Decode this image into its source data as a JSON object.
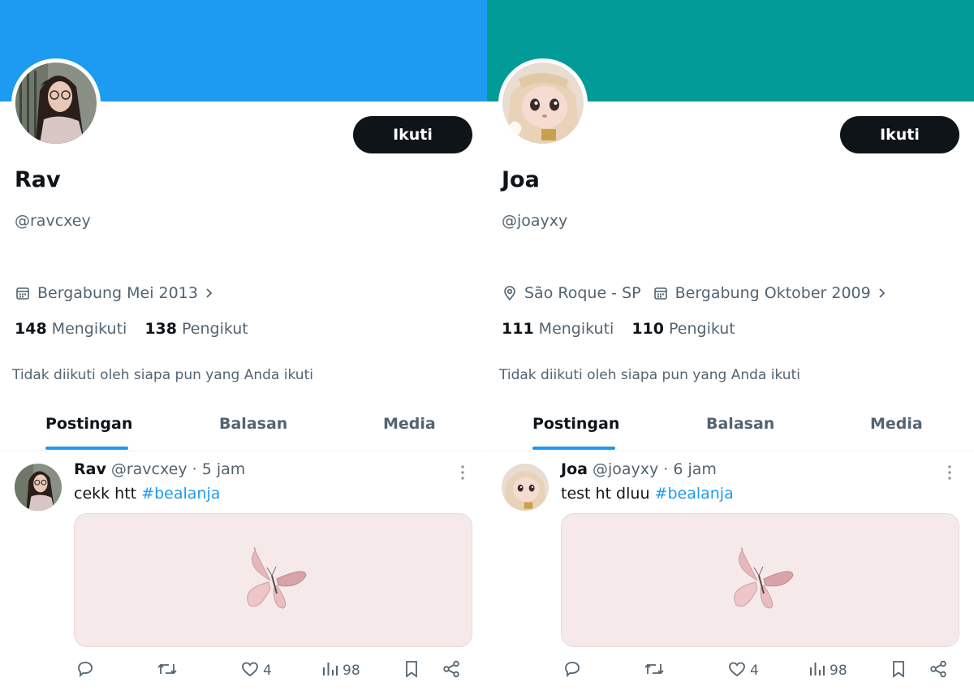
{
  "profiles": [
    {
      "banner_color": "#1d9bf0",
      "display_name": "Rav",
      "handle": "@ravcxey",
      "follow_label": "Ikuti",
      "location": "",
      "joined": "Bergabung Mei 2013",
      "following_count": "148",
      "following_label": "Mengikuti",
      "followers_count": "138",
      "followers_label": "Pengikut",
      "not_followed_text": "Tidak diikuti oleh siapa pun yang Anda ikuti",
      "tabs": [
        "Postingan",
        "Balasan",
        "Media"
      ],
      "active_tab": "Postingan",
      "post": {
        "name": "Rav",
        "handle": "@ravcxey",
        "time": "· 5 jam",
        "text": "cekk htt",
        "hashtag": "#bealanja",
        "likes": "4",
        "views": "98"
      }
    },
    {
      "banner_color": "#009b96",
      "display_name": "Joa",
      "handle": "@joayxy",
      "follow_label": "Ikuti",
      "location": "São Roque - SP",
      "joined": "Bergabung Oktober 2009",
      "following_count": "111",
      "following_label": "Mengikuti",
      "followers_count": "110",
      "followers_label": "Pengikut",
      "not_followed_text": "Tidak diikuti oleh siapa pun yang Anda ikuti",
      "tabs": [
        "Postingan",
        "Balasan",
        "Media"
      ],
      "active_tab": "Postingan",
      "post": {
        "name": "Joa",
        "handle": "@joayxy",
        "time": "· 6 jam",
        "text": "test ht dluu",
        "hashtag": "#bealanja",
        "likes": "4",
        "views": "98"
      }
    }
  ],
  "colors": {
    "text_primary": "#0f1419",
    "text_secondary": "#536471",
    "accent": "#1d9bf0"
  },
  "icons": {
    "calendar": "calendar-icon",
    "location": "location-pin-icon",
    "chevron": "chevron-right-icon",
    "reply": "reply-icon",
    "retweet": "retweet-icon",
    "like": "heart-icon",
    "views": "views-chart-icon",
    "bookmark": "bookmark-icon",
    "share": "share-icon",
    "more": "more-vertical-icon"
  }
}
